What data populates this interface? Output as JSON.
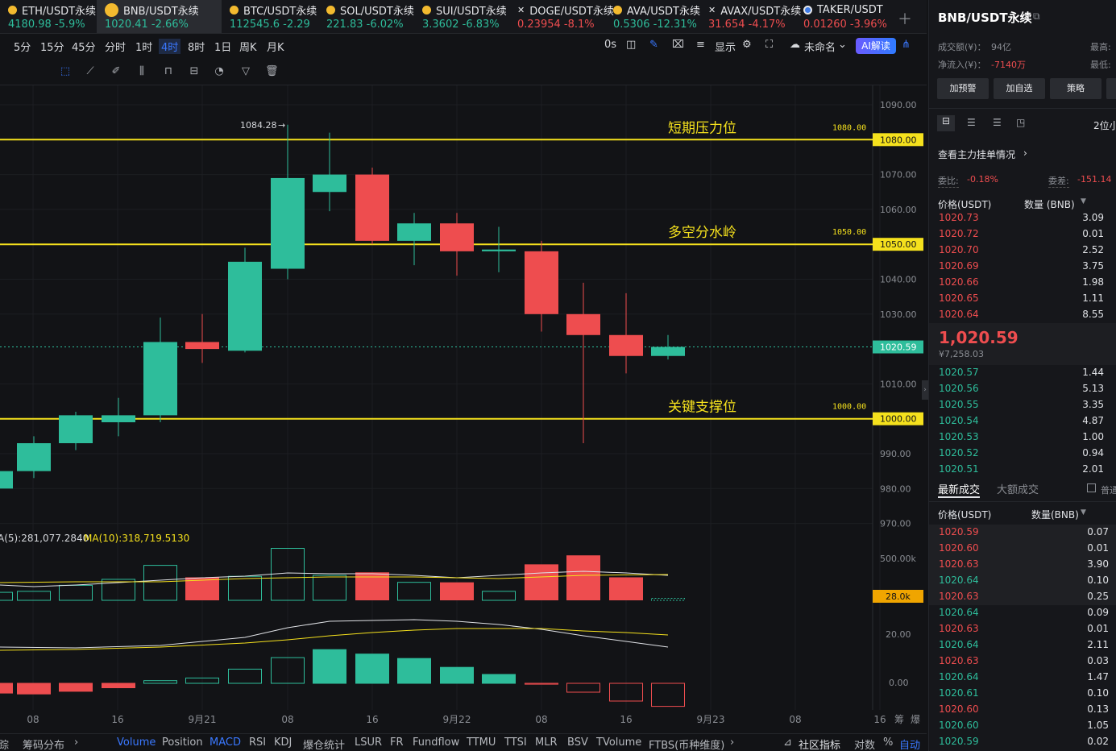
{
  "tabs": [
    {
      "name": "ETH/USDT永续",
      "price": "4180.98",
      "chg": "-5.9%",
      "dir": "up"
    },
    {
      "name": "BNB/USDT永续",
      "price": "1020.41",
      "chg": "-2.66%",
      "dir": "up",
      "active": true
    },
    {
      "name": "BTC/USDT永续",
      "price": "112545.6",
      "chg": "-2.29",
      "dir": "up"
    },
    {
      "name": "SOL/USDT永续",
      "price": "221.83",
      "chg": "-6.02%",
      "dir": "up"
    },
    {
      "name": "SUI/USDT永续",
      "price": "3.3602",
      "chg": "-6.83%",
      "dir": "up"
    },
    {
      "name": "DOGE/USDT永续",
      "price": "0.23954",
      "chg": "-8.1%",
      "dir": "dn"
    },
    {
      "name": "AVA/USDT永续",
      "price": "0.5306",
      "chg": "-12.31%",
      "dir": "up"
    },
    {
      "name": "AVAX/USDT永续",
      "price": "31.654",
      "chg": "-4.17%",
      "dir": "dn"
    },
    {
      "name": "TAKER/USDT",
      "price": "0.01260",
      "chg": "-3.96%",
      "dir": "dn"
    }
  ],
  "timeframes": [
    "5分",
    "15分",
    "45分",
    "分时",
    "1时",
    "4时",
    "8时",
    "1日",
    "周K",
    "月K"
  ],
  "active_timeframe": "4时",
  "toolbar_right": {
    "countdown": "0s",
    "display": "显示",
    "unnamed": "未命名",
    "ai": "AI解读"
  },
  "chart": {
    "y_ticks": [
      "1090.00",
      "1080.00",
      "1070.00",
      "1060.00",
      "1050.00",
      "1040.00",
      "1030.00",
      "1020.59",
      "1010.00",
      "1000.00",
      "990.00",
      "980.00",
      "970.00"
    ],
    "x_ticks": [
      "08",
      "16",
      "9月21",
      "08",
      "16",
      "9月22",
      "08",
      "16",
      "9月23",
      "08",
      "16"
    ],
    "high_label": "1084.28",
    "levels": [
      {
        "label": "短期压力位",
        "value": "1080.00",
        "tag": "1080.00"
      },
      {
        "label": "多空分水岭",
        "value": "1050.00",
        "tag": "1050.00"
      },
      {
        "label": "关键支撑位",
        "value": "1000.00",
        "tag": "1000.00"
      }
    ],
    "current_price": "1020.59",
    "vol_legend": "A(5):281,077.2840",
    "vol_legend2": "MA(10):318,719.5130",
    "vol_ticks": [
      "500.00k"
    ],
    "vol_current": "28.0k",
    "macd_ticks": [
      "20.00",
      "0.00"
    ],
    "side_labels": [
      "筹",
      "爆"
    ]
  },
  "chart_data": {
    "type": "candlestick",
    "candles": [
      {
        "o": 980,
        "c": 985,
        "h": 986,
        "l": 979,
        "vol": 0.08
      },
      {
        "o": 985,
        "c": 993,
        "h": 995,
        "l": 983,
        "vol": 0.09
      },
      {
        "o": 993,
        "c": 1001,
        "h": 1002,
        "l": 991,
        "vol": 0.15
      },
      {
        "o": 999,
        "c": 1001,
        "h": 1006,
        "l": 995,
        "vol": 0.21
      },
      {
        "o": 1001,
        "c": 1022,
        "h": 1029,
        "l": 999,
        "vol": 0.35
      },
      {
        "o": 1022,
        "c": 1020,
        "h": 1030,
        "l": 1016,
        "vol": 0.23
      },
      {
        "o": 1019.5,
        "c": 1045,
        "h": 1049,
        "l": 1019,
        "vol": 0.24
      },
      {
        "o": 1043,
        "c": 1069,
        "h": 1084.28,
        "l": 1040,
        "vol": 0.52
      },
      {
        "o": 1065,
        "c": 1070,
        "h": 1082,
        "l": 1059.5,
        "vol": 0.25
      },
      {
        "o": 1070,
        "c": 1051,
        "h": 1072,
        "l": 1050,
        "vol": 0.28
      },
      {
        "o": 1051,
        "c": 1056,
        "h": 1059,
        "l": 1044,
        "vol": 0.18
      },
      {
        "o": 1056,
        "c": 1048,
        "h": 1059,
        "l": 1041,
        "vol": 0.18
      },
      {
        "o": 1048,
        "c": 1048.5,
        "h": 1055,
        "l": 1042,
        "vol": 0.09
      },
      {
        "o": 1048,
        "c": 1030,
        "h": 1051,
        "l": 1025,
        "vol": 0.36
      },
      {
        "o": 1030,
        "c": 1024,
        "h": 1039,
        "l": 993,
        "vol": 0.45
      },
      {
        "o": 1024,
        "c": 1018,
        "h": 1036,
        "l": 1013,
        "vol": 0.23
      },
      {
        "o": 1018,
        "c": 1020.59,
        "h": 1024,
        "l": 1017,
        "vol": 0.02
      }
    ],
    "macd_hist": [
      -2.2,
      -2.4,
      -1.8,
      -1,
      0.6,
      1.2,
      3.2,
      5.8,
      7.6,
      6.6,
      5.6,
      3.6,
      2,
      -0.2,
      -2,
      -4,
      -5.2
    ]
  },
  "bottom_bar": {
    "left": [
      "踪",
      "筹码分布"
    ],
    "items": [
      "Volume",
      "Position",
      "MACD",
      "RSI",
      "KDJ",
      "爆仓统计",
      "LSUR",
      "FR",
      "Fundflow",
      "TTMU",
      "TTSI",
      "MLR",
      "BSV",
      "TVolume",
      "FTBS(币种维度)"
    ],
    "active": [
      "Volume",
      "MACD"
    ],
    "right": [
      "社区指标",
      "对数",
      "%",
      "自动"
    ]
  },
  "side": {
    "title": "BNB/USDT永续",
    "turnover_label": "成交额(¥)：",
    "turnover": "94亿",
    "inflow_label": "净流入(¥)：",
    "inflow": "-7140万",
    "high_label": "最高:",
    "low_label": "最低:",
    "buttons": [
      "加预警",
      "加自选",
      "策略"
    ],
    "precision": "2位小",
    "link": "查看主力挂单情况",
    "ratio_label": "委比:",
    "ratio": "-0.18%",
    "diff_label": "委差:",
    "diff": "-151.14",
    "ob_hdr_price": "价格(USDT)",
    "ob_hdr_qty": "数量 (BNB)",
    "asks": [
      [
        "1020.73",
        "3.09"
      ],
      [
        "1020.72",
        "0.01"
      ],
      [
        "1020.70",
        "2.52"
      ],
      [
        "1020.69",
        "3.75"
      ],
      [
        "1020.66",
        "1.98"
      ],
      [
        "1020.65",
        "1.11"
      ],
      [
        "1020.64",
        "8.55"
      ]
    ],
    "last": "1,020.59",
    "last_cny": "¥7,258.03",
    "bids": [
      [
        "1020.57",
        "1.44"
      ],
      [
        "1020.56",
        "5.13"
      ],
      [
        "1020.55",
        "3.35"
      ],
      [
        "1020.54",
        "4.87"
      ],
      [
        "1020.53",
        "1.00"
      ],
      [
        "1020.52",
        "0.94"
      ],
      [
        "1020.51",
        "2.01"
      ]
    ],
    "trade_tab1": "最新成交",
    "trade_tab2": "大额成交",
    "trade_check": "普通",
    "tr_hdr_price": "价格(USDT)",
    "tr_hdr_qty": "数量(BNB)",
    "trades": [
      [
        "1020.59",
        "0.07",
        "dn"
      ],
      [
        "1020.60",
        "0.01",
        "dn"
      ],
      [
        "1020.63",
        "3.90",
        "dn"
      ],
      [
        "1020.64",
        "0.10",
        "up"
      ],
      [
        "1020.63",
        "0.25",
        "dn"
      ],
      [
        "1020.64",
        "0.09",
        "up"
      ],
      [
        "1020.63",
        "0.01",
        "dn"
      ],
      [
        "1020.64",
        "2.11",
        "up"
      ],
      [
        "1020.63",
        "0.03",
        "dn"
      ],
      [
        "1020.64",
        "1.47",
        "up"
      ],
      [
        "1020.61",
        "0.10",
        "up"
      ],
      [
        "1020.60",
        "0.13",
        "dn"
      ],
      [
        "1020.60",
        "1.05",
        "up"
      ],
      [
        "1020.59",
        "0.02",
        "up"
      ]
    ]
  }
}
